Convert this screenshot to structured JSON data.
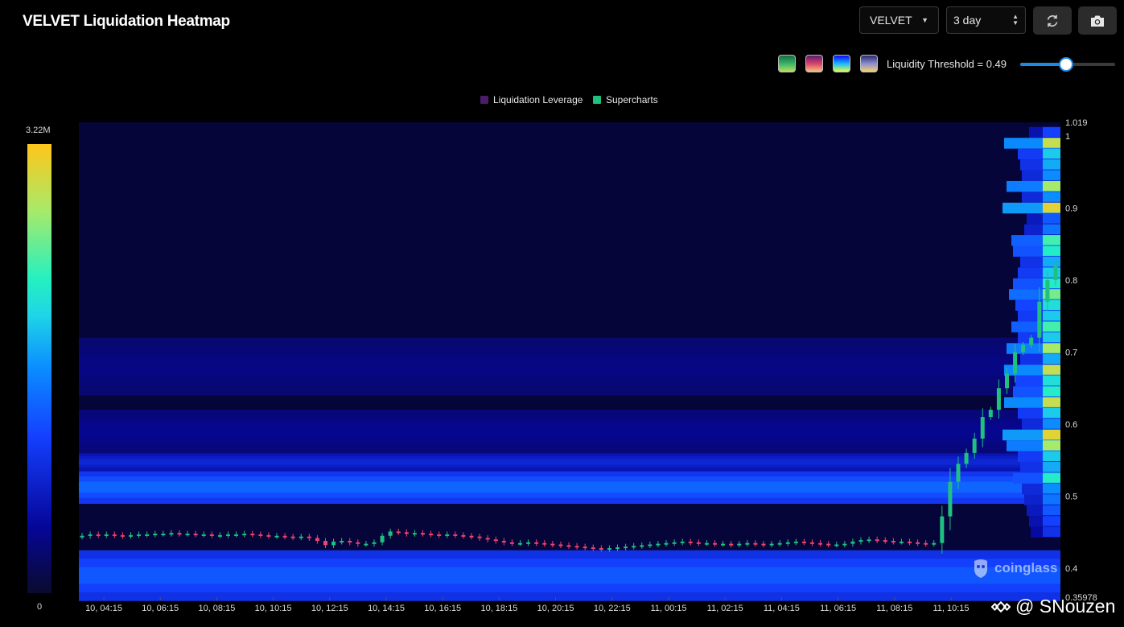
{
  "header": {
    "title": "VELVET Liquidation Heatmap",
    "symbol_value": "VELVET",
    "range_value": "3 day"
  },
  "icons": {
    "refresh": "refresh-icon",
    "camera": "camera-icon",
    "coinglass": "coinglass-logo",
    "binance": "binance-logo"
  },
  "threshold": {
    "label": "Liquidity Threshold = 0.49",
    "value": 0.49
  },
  "palettes": [
    {
      "name": "palette-1",
      "colors": [
        "#1b6b3a",
        "#39b36b",
        "#b8e05a"
      ]
    },
    {
      "name": "palette-2",
      "colors": [
        "#5b1d6e",
        "#d9406b",
        "#f7c17a"
      ]
    },
    {
      "name": "palette-3",
      "colors": [
        "#0a0aff",
        "#19b7ff",
        "#e0ff4a"
      ]
    },
    {
      "name": "palette-4",
      "colors": [
        "#2a2a6e",
        "#8c8cd0",
        "#f5d36a"
      ]
    }
  ],
  "legend": {
    "items": [
      {
        "label": "Liquidation Leverage",
        "color": "#4a1d6b"
      },
      {
        "label": "Supercharts",
        "color": "#20c080"
      }
    ]
  },
  "colorbar": {
    "max_label": "3.22M",
    "min_label": "0"
  },
  "watermark": {
    "brand": "coinglass",
    "credit": "@ SNouzen"
  },
  "chart_data": {
    "type": "heatmap",
    "title": "VELVET Liquidation Heatmap",
    "x_ticks": [
      "10, 04:15",
      "10, 06:15",
      "10, 08:15",
      "10, 10:15",
      "10, 12:15",
      "10, 14:15",
      "10, 16:15",
      "10, 18:15",
      "10, 20:15",
      "10, 22:15",
      "11, 00:15",
      "11, 02:15",
      "11, 04:15",
      "11, 06:15",
      "11, 08:15",
      "11, 10:15"
    ],
    "y_ticks": [
      "1.019",
      "1",
      "0.9",
      "0.8",
      "0.7",
      "0.6",
      "0.5",
      "0.4",
      "0.35978"
    ],
    "ylim": [
      0.35978,
      1.019
    ],
    "color_scale": {
      "min": 0,
      "max": "3.22M"
    },
    "heat_bands": [
      {
        "from": 0.355,
        "to": 0.425,
        "intensity": 0.42
      },
      {
        "from": 0.49,
        "to": 0.535,
        "intensity": 0.45
      },
      {
        "from": 0.535,
        "to": 0.56,
        "intensity": 0.28
      },
      {
        "from": 0.56,
        "to": 0.62,
        "intensity": 0.14
      },
      {
        "from": 0.64,
        "to": 0.72,
        "intensity": 0.12
      }
    ],
    "candles": {
      "series": "Supercharts",
      "close": [
        0.445,
        0.447,
        0.446,
        0.447,
        0.446,
        0.445,
        0.446,
        0.447,
        0.447,
        0.448,
        0.448,
        0.449,
        0.448,
        0.448,
        0.447,
        0.447,
        0.446,
        0.446,
        0.447,
        0.447,
        0.448,
        0.447,
        0.446,
        0.445,
        0.445,
        0.444,
        0.443,
        0.444,
        0.442,
        0.438,
        0.432,
        0.437,
        0.438,
        0.436,
        0.434,
        0.434,
        0.436,
        0.445,
        0.451,
        0.45,
        0.448,
        0.449,
        0.448,
        0.447,
        0.446,
        0.447,
        0.446,
        0.445,
        0.444,
        0.442,
        0.44,
        0.438,
        0.436,
        0.435,
        0.435,
        0.436,
        0.435,
        0.434,
        0.433,
        0.432,
        0.431,
        0.43,
        0.429,
        0.428,
        0.427,
        0.428,
        0.429,
        0.43,
        0.431,
        0.432,
        0.433,
        0.434,
        0.435,
        0.436,
        0.437,
        0.436,
        0.435,
        0.435,
        0.434,
        0.434,
        0.433,
        0.434,
        0.435,
        0.434,
        0.433,
        0.434,
        0.435,
        0.436,
        0.437,
        0.436,
        0.435,
        0.434,
        0.433,
        0.433,
        0.434,
        0.437,
        0.439,
        0.44,
        0.439,
        0.438,
        0.437,
        0.437,
        0.436,
        0.435,
        0.434,
        0.435,
        0.472,
        0.52,
        0.545,
        0.56,
        0.58,
        0.61,
        0.62,
        0.65,
        0.67,
        0.7,
        0.71,
        0.72,
        0.77,
        0.8,
        0.82
      ]
    },
    "right_edge_heat": [
      {
        "price": 1.005,
        "intensity": 0.35
      },
      {
        "price": 0.99,
        "intensity": 0.9
      },
      {
        "price": 0.975,
        "intensity": 0.6
      },
      {
        "price": 0.96,
        "intensity": 0.55
      },
      {
        "price": 0.945,
        "intensity": 0.5
      },
      {
        "price": 0.93,
        "intensity": 0.85
      },
      {
        "price": 0.915,
        "intensity": 0.5
      },
      {
        "price": 0.9,
        "intensity": 0.95
      },
      {
        "price": 0.885,
        "intensity": 0.4
      },
      {
        "price": 0.87,
        "intensity": 0.45
      },
      {
        "price": 0.855,
        "intensity": 0.75
      },
      {
        "price": 0.84,
        "intensity": 0.7
      },
      {
        "price": 0.825,
        "intensity": 0.55
      },
      {
        "price": 0.81,
        "intensity": 0.6
      },
      {
        "price": 0.795,
        "intensity": 0.7
      },
      {
        "price": 0.78,
        "intensity": 0.8
      },
      {
        "price": 0.765,
        "intensity": 0.65
      },
      {
        "price": 0.75,
        "intensity": 0.6
      },
      {
        "price": 0.735,
        "intensity": 0.75
      },
      {
        "price": 0.72,
        "intensity": 0.6
      },
      {
        "price": 0.705,
        "intensity": 0.85
      },
      {
        "price": 0.69,
        "intensity": 0.55
      },
      {
        "price": 0.675,
        "intensity": 0.9
      },
      {
        "price": 0.66,
        "intensity": 0.65
      },
      {
        "price": 0.645,
        "intensity": 0.7
      },
      {
        "price": 0.63,
        "intensity": 0.9
      },
      {
        "price": 0.615,
        "intensity": 0.6
      },
      {
        "price": 0.6,
        "intensity": 0.5
      },
      {
        "price": 0.585,
        "intensity": 0.95
      },
      {
        "price": 0.57,
        "intensity": 0.85
      },
      {
        "price": 0.555,
        "intensity": 0.6
      },
      {
        "price": 0.54,
        "intensity": 0.55
      },
      {
        "price": 0.525,
        "intensity": 0.7
      },
      {
        "price": 0.51,
        "intensity": 0.5
      },
      {
        "price": 0.495,
        "intensity": 0.45
      },
      {
        "price": 0.48,
        "intensity": 0.4
      },
      {
        "price": 0.465,
        "intensity": 0.35
      },
      {
        "price": 0.45,
        "intensity": 0.3
      }
    ]
  }
}
